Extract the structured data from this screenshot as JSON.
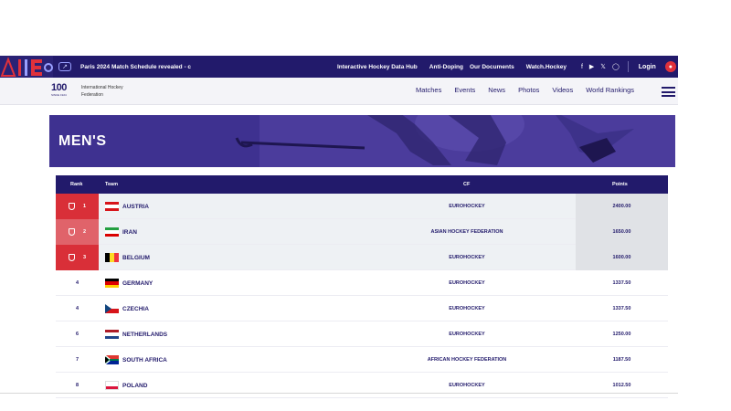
{
  "topbar": {
    "news_ticker": "Paris 2024 Match Schedule revealed - c",
    "links": [
      "Interactive Hockey Data Hub",
      "Anti-Doping",
      "Our Documents",
      "Watch.Hockey"
    ],
    "social_icons": [
      "facebook-icon",
      "youtube-icon",
      "x-icon",
      "instagram-icon"
    ],
    "login_label": "Login"
  },
  "header": {
    "logo_number": "100",
    "logo_since": "SINCE 1924",
    "org_name_line1": "International Hockey",
    "org_name_line2": "Federation",
    "nav": [
      "Matches",
      "Events",
      "News",
      "Photos",
      "Videos",
      "World Rankings"
    ]
  },
  "banner": {
    "title": "MEN'S"
  },
  "table": {
    "headers": {
      "rank": "Rank",
      "team": "Team",
      "cf": "CF",
      "points": "Points"
    },
    "rows": [
      {
        "rank": "1",
        "team": "AUSTRIA",
        "cf": "EUROHOCKEY",
        "points": "2400.00",
        "flag": "austria"
      },
      {
        "rank": "2",
        "team": "IRAN",
        "cf": "ASIAN HOCKEY FEDERATION",
        "points": "1650.00",
        "flag": "iran"
      },
      {
        "rank": "3",
        "team": "BELGIUM",
        "cf": "EUROHOCKEY",
        "points": "1600.00",
        "flag": "belgium"
      },
      {
        "rank": "4",
        "team": "GERMANY",
        "cf": "EUROHOCKEY",
        "points": "1337.50",
        "flag": "germany"
      },
      {
        "rank": "4",
        "team": "CZECHIA",
        "cf": "EUROHOCKEY",
        "points": "1337.50",
        "flag": "czechia"
      },
      {
        "rank": "6",
        "team": "NETHERLANDS",
        "cf": "EUROHOCKEY",
        "points": "1250.00",
        "flag": "netherlands"
      },
      {
        "rank": "7",
        "team": "SOUTH AFRICA",
        "cf": "AFRICAN HOCKEY FEDERATION",
        "points": "1187.50",
        "flag": "south-africa"
      },
      {
        "rank": "8",
        "team": "POLAND",
        "cf": "EUROHOCKEY",
        "points": "1012.50",
        "flag": "poland"
      }
    ]
  },
  "colors": {
    "brand_navy": "#221a6b",
    "accent_red": "#d92f38",
    "banner_purple": "#4b3c9c"
  }
}
